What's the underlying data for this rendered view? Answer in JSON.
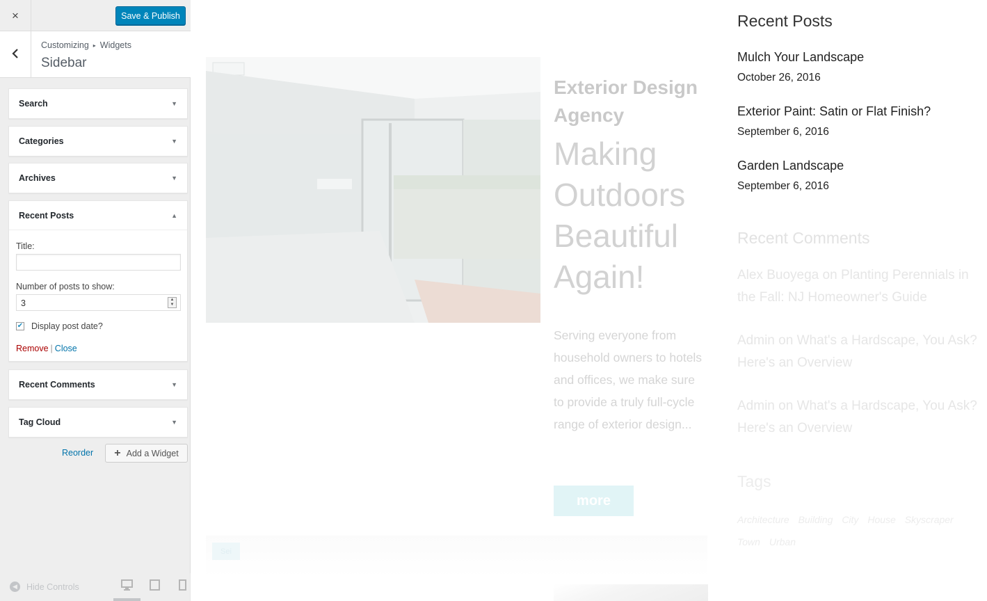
{
  "customizer": {
    "close_icon": "×",
    "save_label": "Save & Publish",
    "back_icon": "‹",
    "breadcrumb_root": "Customizing",
    "breadcrumb_sep": "▸",
    "breadcrumb_child": "Widgets",
    "section_title": "Sidebar",
    "widgets": [
      {
        "title": "Search",
        "open": false
      },
      {
        "title": "Categories",
        "open": false
      },
      {
        "title": "Archives",
        "open": false
      },
      {
        "title": "Recent Posts",
        "open": true
      },
      {
        "title": "Recent Comments",
        "open": false
      },
      {
        "title": "Tag Cloud",
        "open": false
      }
    ],
    "arrow_closed": "▼",
    "arrow_open": "▲",
    "recent_posts_form": {
      "title_label": "Title:",
      "title_value": "",
      "count_label": "Number of posts to show:",
      "count_value": "3",
      "show_date_label": "Display post date?",
      "show_date_checked": true,
      "remove_label": "Remove",
      "separator": "|",
      "close_label": "Close"
    },
    "reorder_label": "Reorder",
    "add_widget_label": "Add a Widget",
    "hide_controls_label": "Hide Controls",
    "accent_color": "#0085ba"
  },
  "preview": {
    "main_title": "Exterior Design Agency",
    "headline": "Making Outdoors Beautiful Again!",
    "body_text": "Serving everyone from household owners to ho­tels and offices, we make sure to provide a truly full-cycle range of exterior design...",
    "more_label": "more",
    "small_tag": "Sei",
    "recent_posts_heading": "Recent Posts",
    "recent_posts": [
      {
        "title": "Mulch Your Landscape",
        "date": "October 26, 2016"
      },
      {
        "title": "Exterior Paint: Satin or Flat Finish?",
        "date": "September 6, 2016"
      },
      {
        "title": "Garden Landscape",
        "date": "September 6, 2016"
      }
    ],
    "recent_comments_heading": "Recent Comments",
    "comments": [
      {
        "author": "Alex Buoyega",
        "on": "on",
        "post": "Planting Perennials in the Fall: NJ Homeowner's Guide"
      },
      {
        "author": "Admin",
        "on": "on",
        "post": "What's a Hardscape, You Ask? Here's an Overview"
      },
      {
        "author": "Admin",
        "on": "on",
        "post": "What's a Hardscape, You Ask? Here's an Overview"
      }
    ],
    "tags_heading": "Tags",
    "tags": [
      "Architecture",
      "Building",
      "City",
      "House",
      "Skyscraper",
      "Town",
      "Urban"
    ]
  }
}
